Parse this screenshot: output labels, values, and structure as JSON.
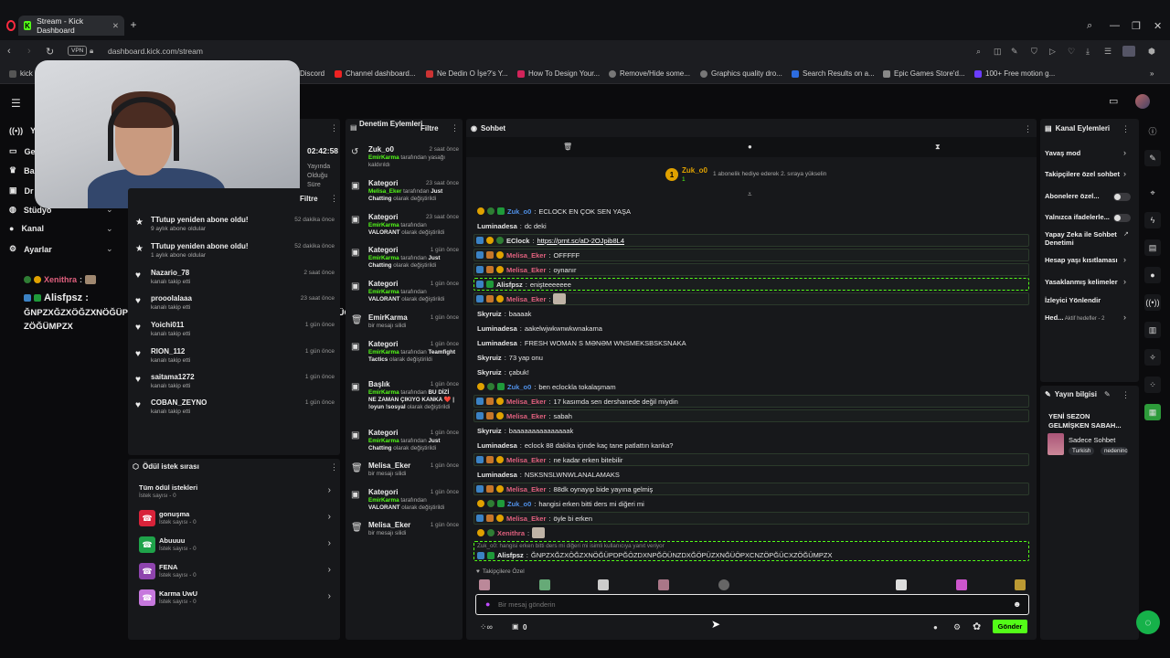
{
  "browser": {
    "tab_title": "Stream - Kick Dashboard",
    "url": "dashboard.kick.com/stream",
    "vpn": "VPN",
    "bookmarks": [
      "kick",
      "Discord",
      "Channel dashboard...",
      "Ne Dedin O İşe?'s Y...",
      "How To Design Your...",
      "Remove/Hide some...",
      "Graphics quality dro...",
      "Search Results on a...",
      "Epic Games Store'd...",
      "100+ Free motion g..."
    ]
  },
  "left_nav": {
    "items": [
      {
        "label": "Yay",
        "icon": "broadcast-icon"
      },
      {
        "label": "Ge",
        "icon": "monitor-icon"
      },
      {
        "label": "Ba",
        "icon": "trophy-icon"
      },
      {
        "label": "Dr",
        "icon": "gift-icon"
      },
      {
        "label": "Stüdyo",
        "icon": "globe-icon"
      },
      {
        "label": "Kanal",
        "icon": "user-icon"
      },
      {
        "label": "Ayarlar",
        "icon": "gear-icon"
      }
    ],
    "chat_preview": {
      "user1": "Xenithra",
      "user2": "Alisfpsz",
      "message": "ĞNPZXĞZXÖĞZXNÖĞÜPDPĞÖZDXNPĞÖÜNZDXĞÖPÜZXNĞÜÖPXCNZÖPĞÜCXZÖĞÜMPZX"
    }
  },
  "stream_info": {
    "timer": "02:42:58",
    "status_lines": [
      "Yayında",
      "Olduğu",
      "Süre"
    ]
  },
  "events": {
    "filter_label": "Filtre",
    "items": [
      {
        "title": "TTutup yeniden abone oldu!",
        "sub": "9 aylık abone oldular",
        "time": "52 dakika önce",
        "icon": "star-icon"
      },
      {
        "title": "TTutup yeniden abone oldu!",
        "sub": "1 aylık abone oldular",
        "time": "52 dakika önce",
        "icon": "star-icon"
      },
      {
        "title": "Nazario_78",
        "sub": "kanalı takip etti",
        "time": "2 saat önce",
        "icon": "heart-icon"
      },
      {
        "title": "prooolalaaa",
        "sub": "kanalı takip etti",
        "time": "23 saat önce",
        "icon": "heart-icon"
      },
      {
        "title": "Yoichi011",
        "sub": "kanalı takip etti",
        "time": "1 gün önce",
        "icon": "heart-icon"
      },
      {
        "title": "RION_112",
        "sub": "kanalı takip etti",
        "time": "1 gün önce",
        "icon": "heart-icon"
      },
      {
        "title": "saitama1272",
        "sub": "kanalı takip etti",
        "time": "1 gün önce",
        "icon": "heart-icon"
      },
      {
        "title": "COBAN_ZEYNO",
        "sub": "kanalı takip etti",
        "time": "1 gün önce",
        "icon": "heart-icon"
      }
    ]
  },
  "rewards": {
    "title": "Ödül istek sırası",
    "all_label": "Tüm ödül istekleri",
    "all_count": "İstek sayısı - 0",
    "items": [
      {
        "name": "gonuşma",
        "count": "İstek sayısı - 0",
        "color": "#d8233a"
      },
      {
        "name": "Abuuuu",
        "count": "İstek sayısı - 0",
        "color": "#1fa34a"
      },
      {
        "name": "FENA",
        "count": "İstek sayısı - 0",
        "color": "#8e44ad"
      },
      {
        "name": "Karma UwU",
        "count": "İstek sayısı - 0",
        "color": "#c678dd"
      }
    ]
  },
  "moderation": {
    "title": "Denetim Eylemleri",
    "filter_label": "Filtre",
    "items": [
      {
        "title": "Zuk_o0",
        "time": "2 saat önce",
        "lines": [
          [
            "g",
            "EmirKarma"
          ],
          [
            "n",
            " tarafından yasağı kaldırıldı"
          ]
        ]
      },
      {
        "title": "Kategori",
        "time": "23 saat önce",
        "lines": [
          [
            "g",
            "Melisa_Eker"
          ],
          [
            "n",
            " tarafından "
          ],
          [
            "w",
            "Just Chatting"
          ],
          [
            "n",
            " olarak değiştirildi"
          ]
        ]
      },
      {
        "title": "Kategori",
        "time": "23 saat önce",
        "lines": [
          [
            "g",
            "EmirKarma"
          ],
          [
            "n",
            " tarafından "
          ],
          [
            "w",
            "VALORANT"
          ],
          [
            "n",
            " olarak değiştirildi"
          ]
        ]
      },
      {
        "title": "Kategori",
        "time": "1 gün önce",
        "lines": [
          [
            "g",
            "EmirKarma"
          ],
          [
            "n",
            " tarafından "
          ],
          [
            "w",
            "Just Chatting"
          ],
          [
            "n",
            " olarak değiştirildi"
          ]
        ]
      },
      {
        "title": "Kategori",
        "time": "1 gün önce",
        "lines": [
          [
            "g",
            "EmirKarma"
          ],
          [
            "n",
            " tarafından "
          ],
          [
            "w",
            "VALORANT"
          ],
          [
            "n",
            " olarak değiştirildi"
          ]
        ]
      },
      {
        "title": "EmirKarma",
        "time": "1 gün önce",
        "lines": [
          [
            "n",
            "bir mesajı silidi"
          ]
        ]
      },
      {
        "title": "Kategori",
        "time": "1 gün önce",
        "lines": [
          [
            "g",
            "EmirKarma"
          ],
          [
            "n",
            " tarafından "
          ],
          [
            "w",
            "Teamfight Tactics"
          ],
          [
            "n",
            " olarak değiştirildi"
          ]
        ]
      },
      {
        "title": "Başlık",
        "time": "1 gün önce",
        "lines": [
          [
            "g",
            "EmirKarma"
          ],
          [
            "n",
            " tarafından "
          ],
          [
            "w",
            "BU DİZİ NE ZAMAN ÇIKIYO KANKA ❤️ | !oyun !sosyal"
          ],
          [
            "n",
            " olarak değiştirildi"
          ]
        ]
      },
      {
        "title": "Kategori",
        "time": "1 gün önce",
        "lines": [
          [
            "g",
            "EmirKarma"
          ],
          [
            "n",
            " tarafından "
          ],
          [
            "w",
            "Just Chatting"
          ],
          [
            "n",
            " olarak değiştirildi"
          ]
        ]
      },
      {
        "title": "Melisa_Eker",
        "time": "1 gün önce",
        "lines": [
          [
            "n",
            "bir mesajı silidi"
          ]
        ]
      },
      {
        "title": "Kategori",
        "time": "1 gün önce",
        "lines": [
          [
            "g",
            "EmirKarma"
          ],
          [
            "n",
            " tarafından "
          ],
          [
            "w",
            "VALORANT"
          ],
          [
            "n",
            " olarak değiştirildi"
          ]
        ]
      },
      {
        "title": "Melisa_Eker",
        "time": "1 gün önce",
        "lines": [
          [
            "n",
            "bir mesajı silidi"
          ]
        ]
      }
    ]
  },
  "chat": {
    "title": "Sohbet",
    "pinned_user": "Zuk_o0",
    "pinned_count": "1",
    "pinned_text": "1 abonelik hediye ederek 2. sıraya yükselin",
    "messages": [
      {
        "user": "Zuk_o0",
        "color": "#4f8fe6",
        "text": "ECLOCK EN ÇOK SEN YAŞA",
        "badges": [
          "gold",
          "gs",
          "green"
        ],
        "hl": false
      },
      {
        "user": "Luminadesa",
        "color": "#e6e6e6",
        "text": "dc deki",
        "badges": [],
        "hl": false
      },
      {
        "user": "EClock",
        "color": "#e6e6e6",
        "text": "https://prnt.sc/aD-2OJpib8L4",
        "badges": [
          "blue",
          "gold",
          "gs"
        ],
        "hl": true,
        "link": true
      },
      {
        "user": "Melisa_Eker",
        "color": "#e0607e",
        "text": "OFFFFF",
        "badges": [
          "blue",
          "orange",
          "gold"
        ],
        "hl": true
      },
      {
        "user": "Melisa_Eker",
        "color": "#e0607e",
        "text": "oynanır",
        "badges": [
          "blue",
          "orange",
          "gold"
        ],
        "hl": true
      },
      {
        "user": "Alisfpsz",
        "color": "#e6e6e6",
        "text": "enişteeeeeee",
        "badges": [
          "blue",
          "green"
        ],
        "hl": true,
        "dash": true
      },
      {
        "user": "Melisa_Eker",
        "color": "#e0607e",
        "text": "",
        "badges": [
          "blue",
          "orange",
          "gold"
        ],
        "hl": true,
        "emote": true
      },
      {
        "user": "Skyruiz",
        "color": "#e6e6e6",
        "text": "baaaak",
        "badges": [],
        "hl": false
      },
      {
        "user": "Luminadesa",
        "color": "#e6e6e6",
        "text": "aakelwjwkwnwkwnakama",
        "badges": [],
        "hl": false
      },
      {
        "user": "Luminadesa",
        "color": "#e6e6e6",
        "text": "FRESH WOMAN S MƏNƏM WNSMEKSBSKSNAKA",
        "badges": [],
        "hl": false
      },
      {
        "user": "Skyruiz",
        "color": "#e6e6e6",
        "text": "73 yap onu",
        "badges": [],
        "hl": false
      },
      {
        "user": "Skyruiz",
        "color": "#e6e6e6",
        "text": "çabuk!",
        "badges": [],
        "hl": false
      },
      {
        "user": "Zuk_o0",
        "color": "#4f8fe6",
        "text": "ben eclockla tokalaşmam",
        "badges": [
          "gold",
          "gs",
          "green"
        ],
        "hl": false
      },
      {
        "user": "Melisa_Eker",
        "color": "#e0607e",
        "text": "17 kasımda sen dershanede değil miydin",
        "badges": [
          "blue",
          "orange",
          "gold"
        ],
        "hl": true
      },
      {
        "user": "Melisa_Eker",
        "color": "#e0607e",
        "text": "sabah",
        "badges": [
          "blue",
          "orange",
          "gold"
        ],
        "hl": true
      },
      {
        "user": "Skyruiz",
        "color": "#e6e6e6",
        "text": "baaaaaaaaaaaaaaak",
        "badges": [],
        "hl": false
      },
      {
        "user": "Luminadesa",
        "color": "#e6e6e6",
        "text": "eclock 88 dakika içinde kaç tane patlattın kanka?",
        "badges": [],
        "hl": false
      },
      {
        "user": "Melisa_Eker",
        "color": "#e0607e",
        "text": "ne kadar erken bitebilir",
        "badges": [
          "blue",
          "orange",
          "gold"
        ],
        "hl": true
      },
      {
        "user": "Luminadesa",
        "color": "#e6e6e6",
        "text": "NSKSNSLWNWLANALAMAKS",
        "badges": [],
        "hl": false
      },
      {
        "user": "Melisa_Eker",
        "color": "#e0607e",
        "text": "88dk oynayıp bide yayına gelmiş",
        "badges": [
          "blue",
          "orange",
          "gold"
        ],
        "hl": true
      },
      {
        "user": "Zuk_o0",
        "color": "#4f8fe6",
        "text": "hangisi erken bitti ders mi diğeri mi",
        "badges": [
          "gold",
          "gs",
          "green"
        ],
        "hl": false
      },
      {
        "user": "Melisa_Eker",
        "color": "#e0607e",
        "text": "öyle bi erken",
        "badges": [
          "blue",
          "orange",
          "gold"
        ],
        "hl": true
      },
      {
        "user": "Xenithra",
        "color": "#e0607e",
        "text": "",
        "badges": [
          "gold",
          "gs"
        ],
        "hl": false,
        "emote": true
      }
    ],
    "reply_hint": "Zuk_o0: hangisi erken bitti ders mi diğeri mi isimli kullanıcıya yanıt veriyor",
    "last_message": {
      "user": "Alisfpsz",
      "text": "ĞNPZXĞZXÖĞZXNÖĞÜPDPĞÖZDXNPĞÖÜNZDXĞÖPÜZXNĞÜÖPXCNZÖPĞÜCXZÖĞÜMPZX"
    },
    "followers_label": "Takipçilere Özel",
    "input_placeholder": "Bir mesaj gönderin",
    "points": "0",
    "send_label": "Gönder"
  },
  "channel_actions": {
    "title": "Kanal Eylemleri",
    "items": [
      {
        "label": "Yavaş mod",
        "control": "chevron"
      },
      {
        "label": "Takipçilere özel sohbet",
        "control": "chevron"
      },
      {
        "label": "Abonelere özel...",
        "control": "toggle"
      },
      {
        "label": "Yalnızca ifadelerle...",
        "control": "toggle"
      },
      {
        "label": "Yapay Zeka ile Sohbet Denetimi",
        "control": "external"
      },
      {
        "label": "Hesap yaşı kısıtlaması",
        "control": "chevron"
      },
      {
        "label": "Yasaklanmış kelimeler",
        "control": "chevron"
      },
      {
        "label": "İzleyici Yönlendir",
        "control": "none"
      },
      {
        "label": "Hed...",
        "control": "chevron",
        "extra": "Aktif hedefler - 2"
      }
    ]
  },
  "stream_card": {
    "title": "Yayın bilgisi",
    "stream_title": "YENİ SEZON GELMİŞKEN SABAH...",
    "category": "Sadece Sohbet",
    "tags": [
      "Turkish",
      "nedeninc"
    ]
  },
  "colors": {
    "kick_green": "#53fc18",
    "bg": "#0b0b0d",
    "panel": "#17181b"
  }
}
